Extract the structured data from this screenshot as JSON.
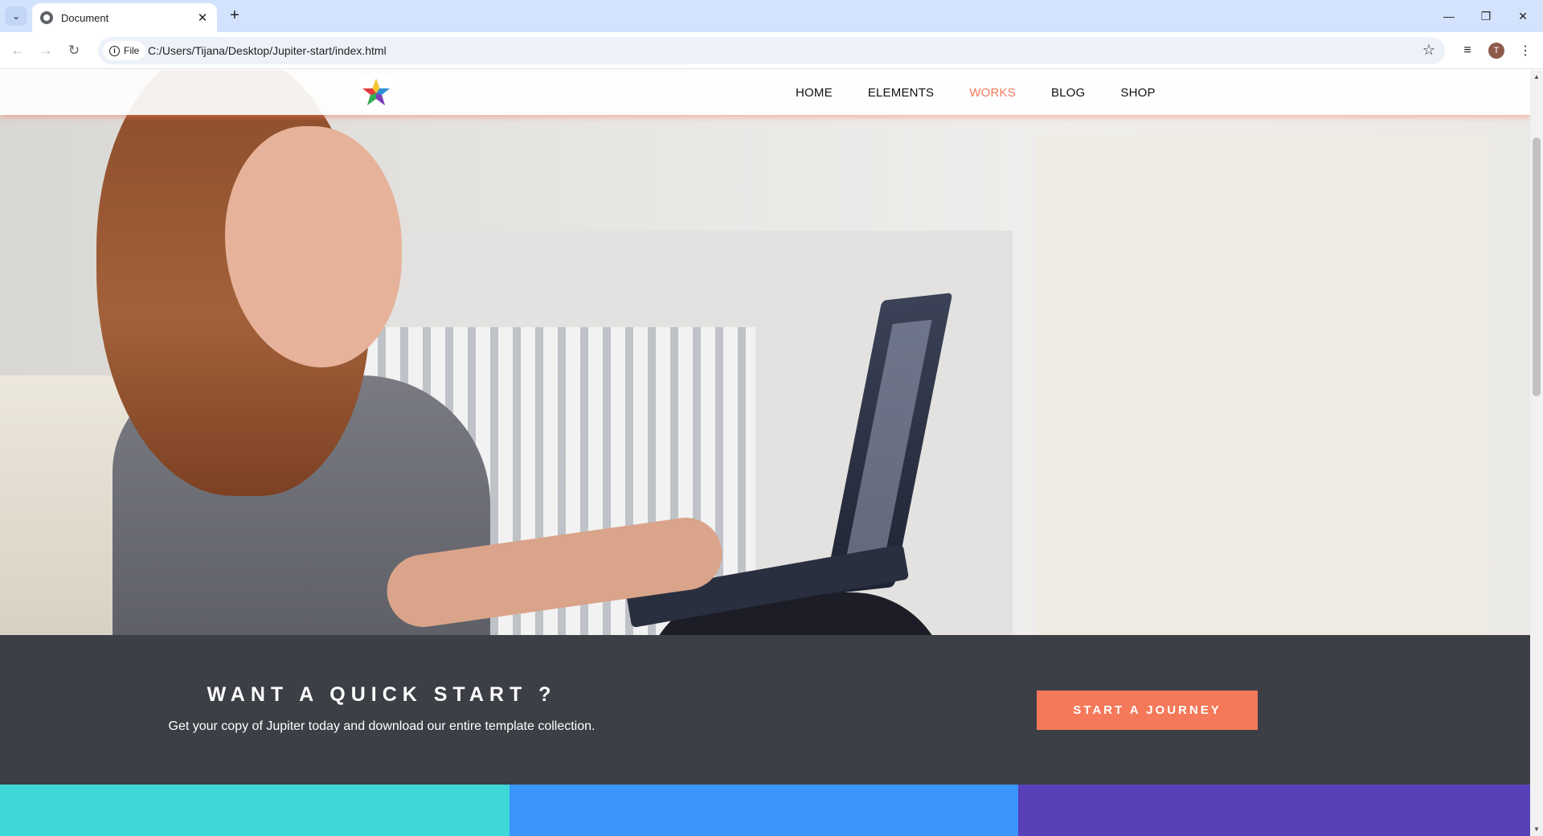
{
  "browser": {
    "tab_title": "Document",
    "tab_close": "✕",
    "new_tab": "+",
    "tab_list": "⌄",
    "url_chip": "File",
    "url": "C:/Users/Tijana/Desktop/Jupiter-start/index.html",
    "profile_initial": "T",
    "icons": {
      "back": "back-arrow-icon",
      "forward": "forward-arrow-icon",
      "reload": "reload-icon",
      "bookmark": "star-icon",
      "media": "media-controls-icon",
      "menu": "kebab-menu-icon"
    }
  },
  "site": {
    "nav": [
      {
        "label": "HOME",
        "active": false
      },
      {
        "label": "ELEMENTS",
        "active": false
      },
      {
        "label": "WORKS",
        "active": true
      },
      {
        "label": "BLOG",
        "active": false
      },
      {
        "label": "SHOP",
        "active": false
      }
    ],
    "accent_color": "#f4795a",
    "cta": {
      "title": "WANT A QUICK START ?",
      "text": "Get your copy of Jupiter today and download our entire template collection.",
      "button": "START A JOURNEY",
      "background": "#3c3f45"
    },
    "strip_colors": [
      "#3fd8d6",
      "#3a96fb",
      "#5a40b8"
    ]
  }
}
